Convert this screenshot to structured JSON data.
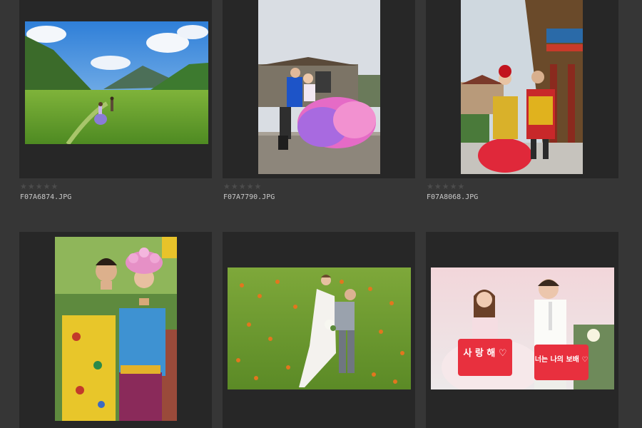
{
  "grid": {
    "items": [
      {
        "filename": "F07A6874.JPG",
        "rating": 0,
        "max_rating": 5,
        "photo": "meadow-mountains"
      },
      {
        "filename": "F07A7790.JPG",
        "rating": 0,
        "max_rating": 5,
        "photo": "couple-on-wall"
      },
      {
        "filename": "F07A8068.JPG",
        "rating": 0,
        "max_rating": 5,
        "photo": "tibetan-temple-couple"
      },
      {
        "filename": "",
        "rating": 0,
        "max_rating": 5,
        "photo": "tibetan-portrait"
      },
      {
        "filename": "",
        "rating": 0,
        "max_rating": 5,
        "photo": "flower-field-couple"
      },
      {
        "filename": "",
        "rating": 0,
        "max_rating": 5,
        "photo": "couple-with-signs"
      }
    ],
    "sign_left": "사 랑 해 ♡",
    "sign_right": "너는 나의 보배 ♡"
  },
  "colors": {
    "background": "#363636",
    "frame": "#272727",
    "star_empty": "#4c4c4c",
    "filename_text": "#c9c9c9"
  },
  "icons": {
    "rating": "star-icon"
  }
}
